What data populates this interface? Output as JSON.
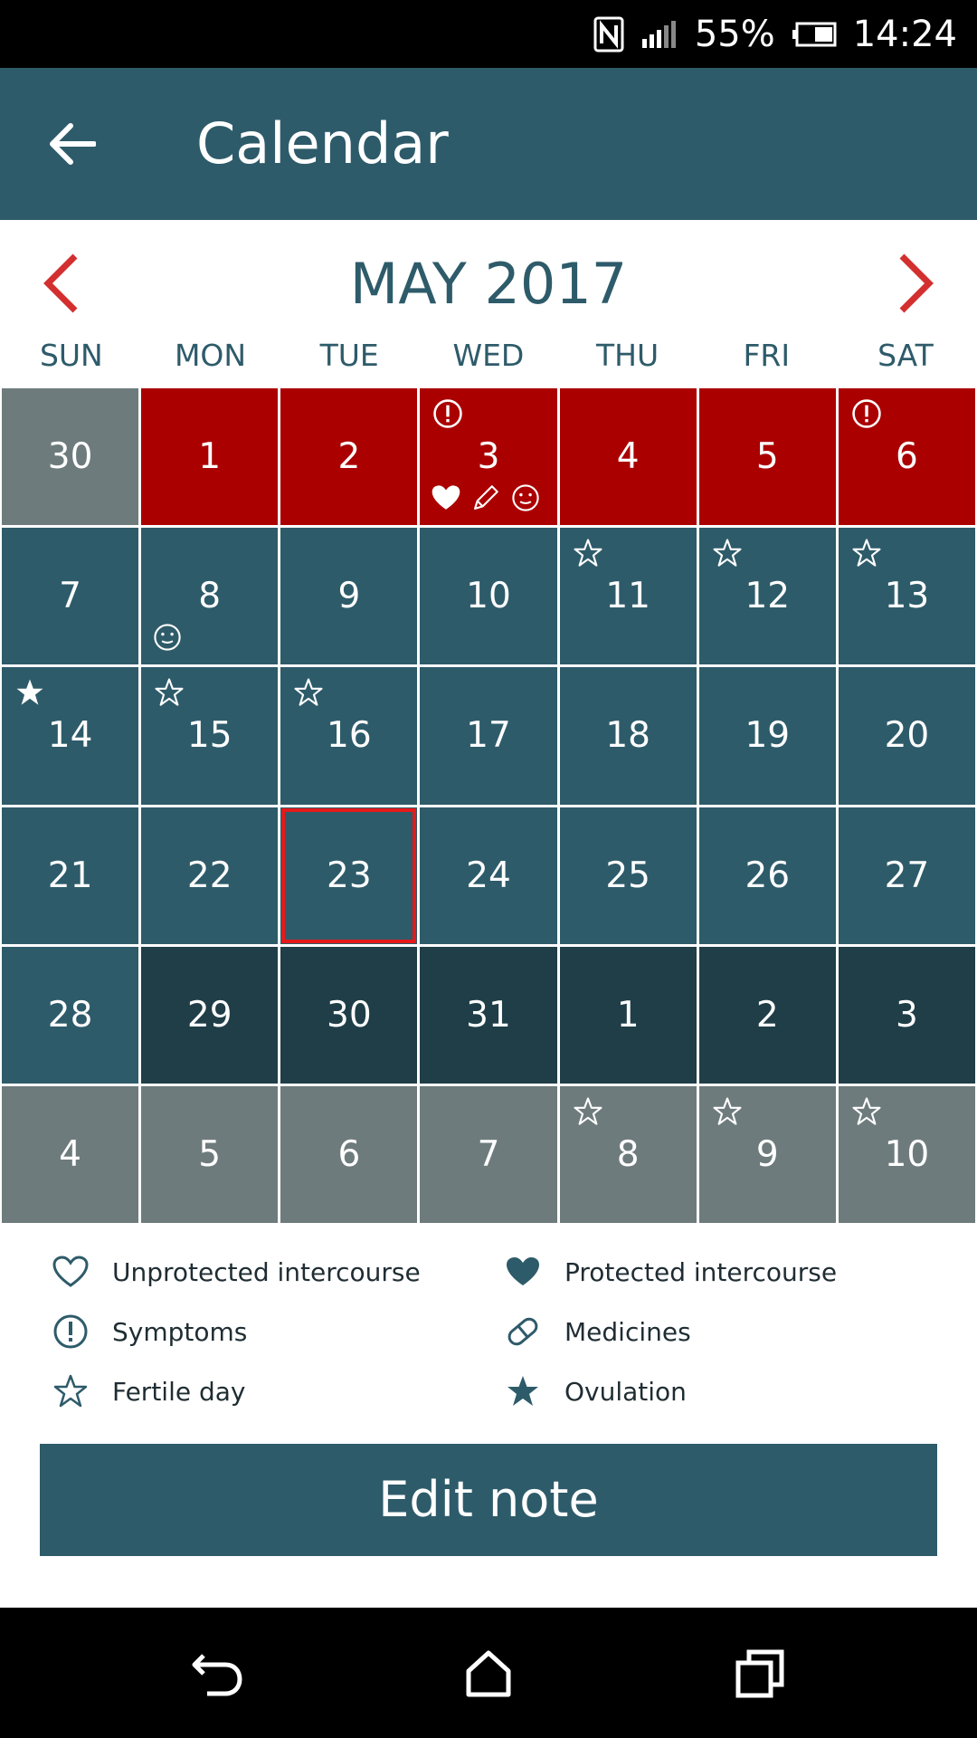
{
  "status_bar": {
    "battery": "55%",
    "time": "14:24",
    "icons": [
      "nfc-icon",
      "signal-icon",
      "battery-icon"
    ]
  },
  "app_bar": {
    "title": "Calendar",
    "back_icon": "arrow-back-icon"
  },
  "month": {
    "label": "MAY 2017",
    "prev_icon": "chevron-left-icon",
    "next_icon": "chevron-right-icon"
  },
  "weekdays": [
    "SUN",
    "MON",
    "TUE",
    "WED",
    "THU",
    "FRI",
    "SAT"
  ],
  "colors": {
    "primary": "#2e5b6a",
    "period": "#ab0000",
    "future_period": "#1f3e48",
    "greyed": "#6e7b7d",
    "selected_outline": "#e51a1a",
    "nav_arrow": "#d32f2f"
  },
  "days": [
    {
      "day": "30",
      "state": "greyed",
      "corner": "",
      "bottom": []
    },
    {
      "day": "1",
      "state": "period",
      "corner": "",
      "bottom": []
    },
    {
      "day": "2",
      "state": "period",
      "corner": "",
      "bottom": []
    },
    {
      "day": "3",
      "state": "period",
      "corner": "symptoms",
      "bottom": [
        "protected-heart",
        "pencil",
        "smiley"
      ]
    },
    {
      "day": "4",
      "state": "period",
      "corner": "",
      "bottom": []
    },
    {
      "day": "5",
      "state": "period",
      "corner": "",
      "bottom": []
    },
    {
      "day": "6",
      "state": "period",
      "corner": "symptoms",
      "bottom": []
    },
    {
      "day": "7",
      "state": "normal",
      "corner": "",
      "bottom": []
    },
    {
      "day": "8",
      "state": "normal",
      "corner": "",
      "bottom": [
        "smiley"
      ]
    },
    {
      "day": "9",
      "state": "normal",
      "corner": "",
      "bottom": []
    },
    {
      "day": "10",
      "state": "normal",
      "corner": "",
      "bottom": []
    },
    {
      "day": "11",
      "state": "normal",
      "corner": "fertile",
      "bottom": []
    },
    {
      "day": "12",
      "state": "normal",
      "corner": "fertile",
      "bottom": []
    },
    {
      "day": "13",
      "state": "normal",
      "corner": "fertile",
      "bottom": []
    },
    {
      "day": "14",
      "state": "normal",
      "corner": "ovulation",
      "bottom": []
    },
    {
      "day": "15",
      "state": "normal",
      "corner": "fertile",
      "bottom": []
    },
    {
      "day": "16",
      "state": "normal",
      "corner": "fertile",
      "bottom": []
    },
    {
      "day": "17",
      "state": "normal",
      "corner": "",
      "bottom": []
    },
    {
      "day": "18",
      "state": "normal",
      "corner": "",
      "bottom": []
    },
    {
      "day": "19",
      "state": "normal",
      "corner": "",
      "bottom": []
    },
    {
      "day": "20",
      "state": "normal",
      "corner": "",
      "bottom": []
    },
    {
      "day": "21",
      "state": "normal",
      "corner": "",
      "bottom": []
    },
    {
      "day": "22",
      "state": "normal",
      "corner": "",
      "bottom": []
    },
    {
      "day": "23",
      "state": "normal",
      "corner": "",
      "bottom": [],
      "selected": true
    },
    {
      "day": "24",
      "state": "normal",
      "corner": "",
      "bottom": []
    },
    {
      "day": "25",
      "state": "normal",
      "corner": "",
      "bottom": []
    },
    {
      "day": "26",
      "state": "normal",
      "corner": "",
      "bottom": []
    },
    {
      "day": "27",
      "state": "normal",
      "corner": "",
      "bottom": []
    },
    {
      "day": "28",
      "state": "normal",
      "corner": "",
      "bottom": []
    },
    {
      "day": "29",
      "state": "dark",
      "corner": "",
      "bottom": []
    },
    {
      "day": "30",
      "state": "dark",
      "corner": "",
      "bottom": []
    },
    {
      "day": "31",
      "state": "dark",
      "corner": "",
      "bottom": []
    },
    {
      "day": "1",
      "state": "dark",
      "corner": "",
      "bottom": []
    },
    {
      "day": "2",
      "state": "dark",
      "corner": "",
      "bottom": []
    },
    {
      "day": "3",
      "state": "dark",
      "corner": "",
      "bottom": []
    },
    {
      "day": "4",
      "state": "greyed",
      "corner": "",
      "bottom": []
    },
    {
      "day": "5",
      "state": "greyed",
      "corner": "",
      "bottom": []
    },
    {
      "day": "6",
      "state": "greyed",
      "corner": "",
      "bottom": []
    },
    {
      "day": "7",
      "state": "greyed",
      "corner": "",
      "bottom": []
    },
    {
      "day": "8",
      "state": "greyed",
      "corner": "fertile",
      "bottom": []
    },
    {
      "day": "9",
      "state": "greyed",
      "corner": "fertile",
      "bottom": []
    },
    {
      "day": "10",
      "state": "greyed",
      "corner": "fertile",
      "bottom": []
    }
  ],
  "legend": [
    {
      "icon": "heart-outline-icon",
      "label": "Unprotected intercourse"
    },
    {
      "icon": "heart-filled-icon",
      "label": "Protected intercourse"
    },
    {
      "icon": "exclamation-circle-icon",
      "label": "Symptoms"
    },
    {
      "icon": "pill-icon",
      "label": "Medicines"
    },
    {
      "icon": "star-outline-icon",
      "label": "Fertile day"
    },
    {
      "icon": "star-filled-icon",
      "label": "Ovulation"
    }
  ],
  "edit_button": {
    "label": "Edit note"
  },
  "nav_bar": {
    "icons": [
      "nav-back-icon",
      "nav-home-icon",
      "nav-recents-icon"
    ]
  }
}
